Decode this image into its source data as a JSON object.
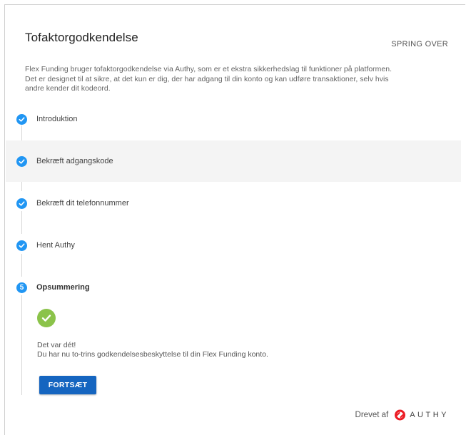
{
  "header": {
    "title": "Tofaktorgodkendelse",
    "skip_label": "SPRING OVER"
  },
  "description": "Flex Funding bruger tofaktorgodkendelse via Authy, som er et ekstra sikkerhedslag til funktioner på platformen. Det er designet til at sikre, at det kun er dig, der har adgang til din konto og kan udføre transaktioner, selv hvis andre kender dit kodeord.",
  "steps": [
    {
      "label": "Introduktion",
      "status": "completed"
    },
    {
      "label": "Bekræft adgangskode",
      "status": "completed"
    },
    {
      "label": "Bekræft dit telefonnummer",
      "status": "completed"
    },
    {
      "label": "Hent Authy",
      "status": "completed"
    },
    {
      "label": "Opsummering",
      "status": "active",
      "number": "5"
    }
  ],
  "summary": {
    "icon": "check-circle-icon",
    "line1": "Det var dét!",
    "line2": "Du har nu to-trins godkendelsesbeskyttelse til din Flex Funding konto.",
    "button_label": "FORTSÆT"
  },
  "footer": {
    "powered_by": "Drevet af",
    "brand": "AUTHY"
  },
  "colors": {
    "step_badge": "#2196f3",
    "success": "#8bc34a",
    "primary_button": "#1565c0",
    "authy_red": "#ec1c24",
    "highlight_row": "#f4f4f4"
  }
}
